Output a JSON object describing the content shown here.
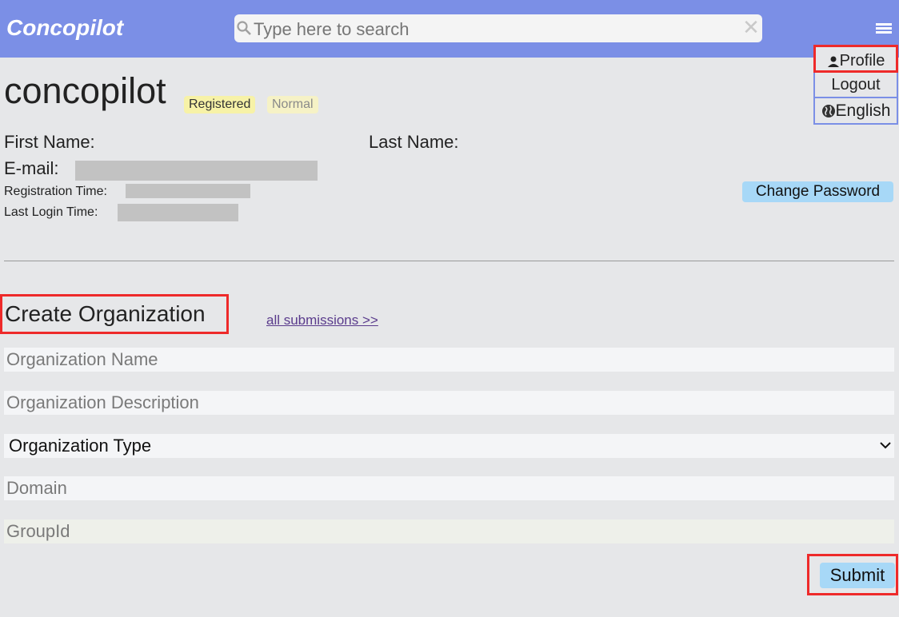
{
  "header": {
    "brand": "Concopilot",
    "search_placeholder": "Type here to search"
  },
  "user_menu": {
    "profile": "Profile",
    "logout": "Logout",
    "language": "English"
  },
  "profile": {
    "username": "concopilot",
    "badges": [
      "Registered",
      "Normal"
    ],
    "first_name_label": "First Name:",
    "last_name_label": "Last Name:",
    "email_label": "E-mail:",
    "registration_time_label": "Registration Time:",
    "last_login_time_label": "Last Login Time:",
    "change_password": "Change Password"
  },
  "create_org": {
    "title": "Create Organization",
    "all_submissions_link": "all submissions >>",
    "name_placeholder": "Organization Name",
    "description_placeholder": "Organization Description",
    "type_selected": "Organization Type",
    "domain_placeholder": "Domain",
    "groupid_placeholder": "GroupId",
    "submit": "Submit"
  },
  "colors": {
    "header_bg": "#7b8fe6",
    "page_bg": "#e6e7e9",
    "accent_button": "#a7d8f7",
    "badge_registered": "#f7f2a7",
    "highlight": "#ee2a2a"
  }
}
